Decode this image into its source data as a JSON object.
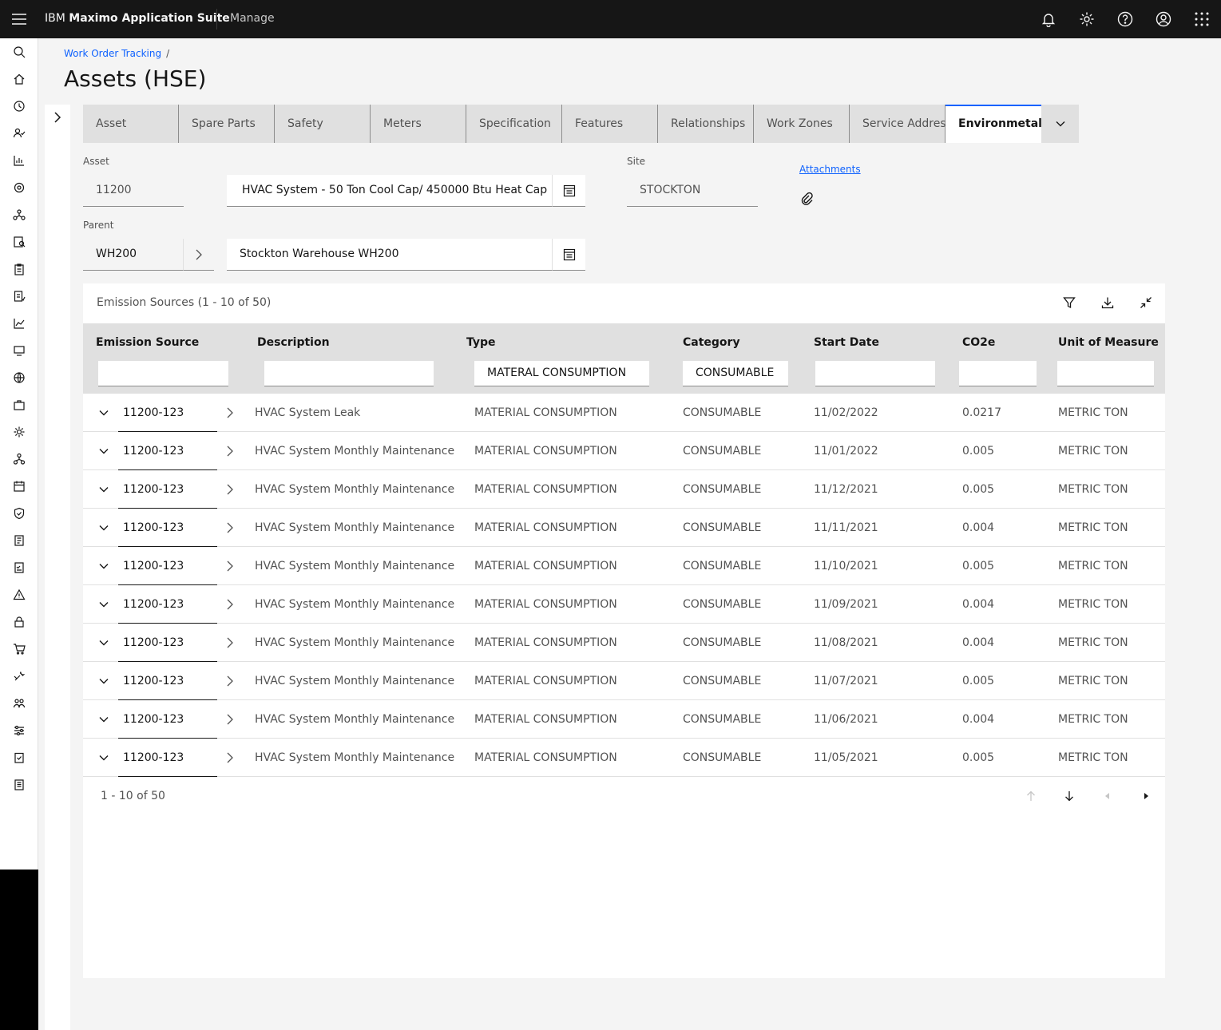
{
  "header": {
    "brand_prefix": "IBM",
    "brand_name": "Maximo Application Suite",
    "product": "Manage",
    "icons": [
      "menu-icon",
      "notification-icon",
      "settings-icon",
      "help-icon",
      "user-icon",
      "app-switcher-icon"
    ]
  },
  "breadcrumb": {
    "parent": "Work Order Tracking",
    "separator": "/"
  },
  "page_title": "Assets (HSE)",
  "tabs": [
    "Asset",
    "Spare Parts",
    "Safety",
    "Meters",
    "Specification",
    "Features",
    "Relationships",
    "Work Zones",
    "Service Address",
    "Environmetal"
  ],
  "active_tab": "Environmetal",
  "form": {
    "asset_label": "Asset",
    "asset_value": "11200",
    "asset_description": "HVAC System - 50 Ton Cool Cap/ 450000 Btu Heat Cap",
    "site_label": "Site",
    "site_value": "STOCKTON",
    "attachments_label": "Attachments",
    "parent_label": "Parent",
    "parent_value": "WH200",
    "parent_description": "Stockton Warehouse WH200"
  },
  "table": {
    "title": "Emission Sources (1 - 10 of 50)",
    "columns": [
      "Emission Source",
      "Description",
      "Type",
      "Category",
      "Start Date",
      "CO2e",
      "Unit of Measure"
    ],
    "filters": {
      "type": "MATERAL CONSUMPTION",
      "category": "CONSUMABLE"
    },
    "rows": [
      {
        "source": "11200-123",
        "description": "HVAC System Leak",
        "type": "MATERIAL CONSUMPTION",
        "category": "CONSUMABLE",
        "start_date": "11/02/2022",
        "co2e": "0.0217",
        "uom": "METRIC TON"
      },
      {
        "source": "11200-123",
        "description": "HVAC System Monthly Maintenance",
        "type": "MATERIAL CONSUMPTION",
        "category": "CONSUMABLE",
        "start_date": "11/01/2022",
        "co2e": "0.005",
        "uom": "METRIC TON"
      },
      {
        "source": "11200-123",
        "description": "HVAC System Monthly Maintenance",
        "type": "MATERIAL CONSUMPTION",
        "category": "CONSUMABLE",
        "start_date": "11/12/2021",
        "co2e": "0.005",
        "uom": "METRIC TON"
      },
      {
        "source": "11200-123",
        "description": "HVAC System Monthly Maintenance",
        "type": "MATERIAL CONSUMPTION",
        "category": "CONSUMABLE",
        "start_date": "11/11/2021",
        "co2e": "0.004",
        "uom": "METRIC TON"
      },
      {
        "source": "11200-123",
        "description": "HVAC System Monthly Maintenance",
        "type": "MATERIAL CONSUMPTION",
        "category": "CONSUMABLE",
        "start_date": "11/10/2021",
        "co2e": "0.005",
        "uom": "METRIC TON"
      },
      {
        "source": "11200-123",
        "description": "HVAC System Monthly Maintenance",
        "type": "MATERIAL CONSUMPTION",
        "category": "CONSUMABLE",
        "start_date": "11/09/2021",
        "co2e": "0.004",
        "uom": "METRIC TON"
      },
      {
        "source": "11200-123",
        "description": "HVAC System Monthly Maintenance",
        "type": "MATERIAL CONSUMPTION",
        "category": "CONSUMABLE",
        "start_date": "11/08/2021",
        "co2e": "0.004",
        "uom": "METRIC TON"
      },
      {
        "source": "11200-123",
        "description": "HVAC System Monthly Maintenance",
        "type": "MATERIAL CONSUMPTION",
        "category": "CONSUMABLE",
        "start_date": "11/07/2021",
        "co2e": "0.005",
        "uom": "METRIC TON"
      },
      {
        "source": "11200-123",
        "description": "HVAC System Monthly Maintenance",
        "type": "MATERIAL CONSUMPTION",
        "category": "CONSUMABLE",
        "start_date": "11/06/2021",
        "co2e": "0.004",
        "uom": "METRIC TON"
      },
      {
        "source": "11200-123",
        "description": "HVAC System Monthly Maintenance",
        "type": "MATERIAL CONSUMPTION",
        "category": "CONSUMABLE",
        "start_date": "11/05/2021",
        "co2e": "0.005",
        "uom": "METRIC TON"
      }
    ],
    "pagination": "1 - 10 of 50"
  },
  "sidenav_icons": [
    "search-icon",
    "home-icon",
    "history-icon",
    "user-check-icon",
    "chart-icon",
    "asset-icon",
    "network-icon",
    "inspection-icon",
    "clipboard-icon",
    "work-order-icon",
    "trend-icon",
    "monitor-icon",
    "globe-icon",
    "briefcase-icon",
    "gear-icon",
    "hierarchy-icon",
    "calendar-icon",
    "shield-icon",
    "report-icon",
    "checklist-icon",
    "alert-icon",
    "lock-icon",
    "cart-icon",
    "tools-icon",
    "people-icon",
    "sliders-icon",
    "task-icon",
    "document-icon"
  ]
}
